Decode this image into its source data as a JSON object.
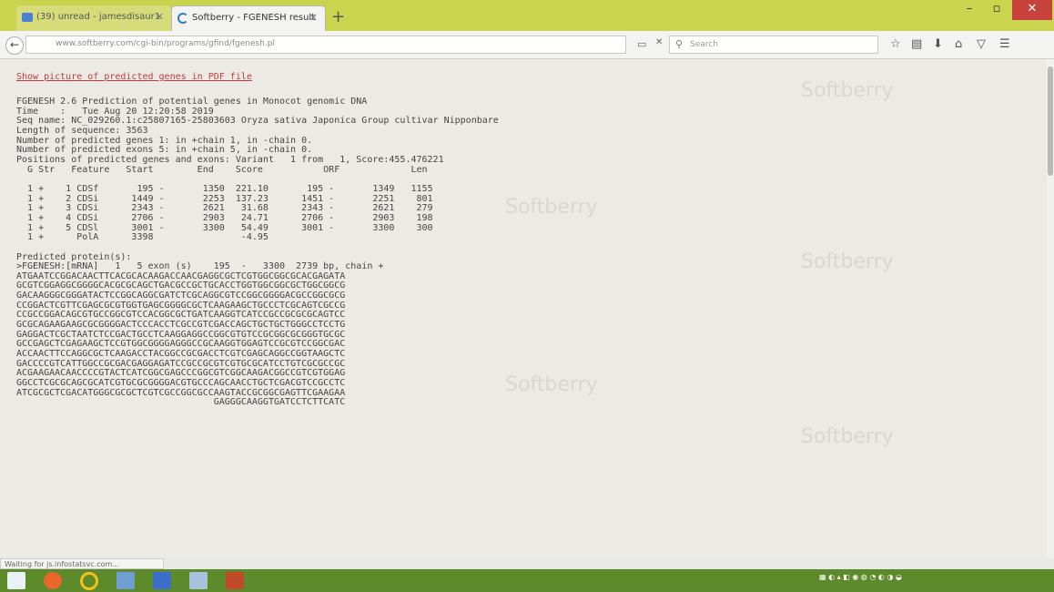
{
  "browser": {
    "tabs": [
      {
        "label": "(39) unread - jamesdisaur1"
      },
      {
        "label": "Softberry - FGENESH result"
      }
    ],
    "url": "www.softberry.com/cgi-bin/programs/gfind/fgenesh.pl",
    "search_placeholder": "Search",
    "status_text": "Waiting for js.infostatsvc.com..."
  },
  "page": {
    "pdf_link": "Show picture of predicted genes in PDF file",
    "watermark": "Softberry",
    "result_lines": [
      "FGENESH 2.6 Prediction of potential genes in Monocot genomic DNA",
      "Time    :   Tue Aug 20 12:20:58 2019",
      "Seq name: NC_029260.1:c25807165-25803603 Oryza sativa Japonica Group cultivar Nipponbare",
      "Length of sequence: 3563",
      "Number of predicted genes 1: in +chain 1, in -chain 0.",
      "Number of predicted exons 5: in +chain 5, in -chain 0.",
      "Positions of predicted genes and exons: Variant   1 from   1, Score:455.476221",
      "  G Str   Feature   Start        End    Score           ORF             Len",
      "",
      "  1 +    1 CDSf       195 -       1350  221.10       195 -       1349   1155",
      "  1 +    2 CDSi      1449 -       2253  137.23      1451 -       2251    801",
      "  1 +    3 CDSi      2343 -       2621   31.68      2343 -       2621    279",
      "  1 +    4 CDSi      2706 -       2903   24.71      2706 -       2903    198",
      "  1 +    5 CDSl      3001 -       3300   54.49      3001 -       3300    300",
      "  1 +      PolA      3398                -4.95",
      "",
      "Predicted protein(s):",
      ">FGENESH:[mRNA]   1   5 exon (s)    195  -   3300  2739 bp, chain +",
      "ATGAATCCGGACAACTTCACGCACAAGACCAACGAGGCGCTCGTGGCGGCGCACGAGATA",
      "GCGTCGGAGGCGGGGCACGCGCAGCTGACGCCGCTGCACCTGGTGGCGGCGCTGGCGGCG",
      "GACAAGGGCGGGATACTCCGGCAGGCGATCTCGCAGGCGTCCGGCGGGGACGCCGGCGCG",
      "CCGGACTCGTTCGAGCGCGTGGTGAGCGGGGCGCTCAAGAAGCTGCCCTCGCAGTCGCCG",
      "CCGCCGGACAGCGTGCCGGCGTCCACGGCGCTGATCAAGGTCATCCGCCGCGCGCAGTCC",
      "GCGCAGAAGAAGCGCGGGGACTCCCACCTCGCCGTCGACCAGCTGCTGCTGGGCCTCCTG",
      "GAGGACTCGCTAATCTCCGACTGCCTCAAGGAGGCCGGCGTGTCCGCGGCGCGGGTGCGC",
      "GCCGAGCTCGAGAAGCTCCGTGGCGGGGAGGGCCGCAAGGTGGAGTCCGCGTCCGGCGAC",
      "ACCAACTTCCAGGCGCTCAAGACCTACGGCCGCGACCTCGTCGAGCAGGCCGGTAAGCTC",
      "GACCCCGTCATTGGCCGCGACGAGGAGATCCGCCGCGTCGTGCGCATCCTGTCGCGCCGC",
      "ACGAAGAACAACCCCGTACTCATCGGCGAGCCCGGCGTCGGCAAGACGGCCGTCGTGGAG",
      "GGCCTCGCGCAGCGCATCGTGCGCGGGGACGTGCCCAGCAACCTGCTCGACGTCCGCCTC",
      "ATCGCGCTCGACATGGGCGCGCTCGTCGCCGGCGCCAAGTACCGCGGCGAGTTCGAAGAA",
      "                                    GAGGGCAAGGTGATCCTCTTCATC"
    ]
  }
}
